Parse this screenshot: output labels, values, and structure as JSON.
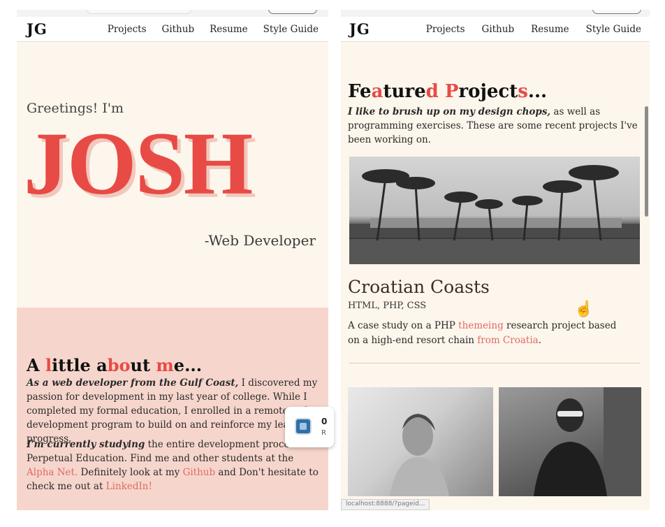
{
  "left_page": {
    "logo": "JG",
    "nav": [
      "Projects",
      "Github",
      "Resume",
      "Style Guide"
    ],
    "hero": {
      "greeting": "Greetings! I'm",
      "name": "JOSH",
      "role": "-Web Developer"
    },
    "about": {
      "title_parts": [
        "A ",
        "l",
        "ittle a",
        "bo",
        "ut ",
        "m",
        "e..."
      ],
      "p1_em": "As a web developer from the Gulf Coast,",
      "p1_text": " I discovered my passion for development in my last year of college. While I completed my formal education, I enrolled in a remote web development program to build on and reinforce my learning progress.",
      "p2_em": "I'm currently studying",
      "p2_text1": " the entire development process at Perpetual Education. Find me and other students at the ",
      "p2_link1": "Alpha Net.",
      "p2_text2": " Definitely look at my ",
      "p2_link2": "Github",
      "p2_text3": " and Don't hesitate to check me out at ",
      "p2_link3": "LinkedIn!"
    }
  },
  "right_page": {
    "logo": "JG",
    "nav": [
      "Projects",
      "Github",
      "Resume",
      "Style Guide"
    ],
    "featured": {
      "title_parts": [
        "Fe",
        "a",
        "ture",
        "d",
        " ",
        "P",
        "roject",
        "s",
        "..."
      ],
      "intro_em": "I like to brush up on my design chops,",
      "intro_text": " as well as programming exercises. These are some recent projects I've been working on."
    },
    "project": {
      "title": "Croatian Coasts",
      "tags": "HTML, PHP, CSS",
      "desc_1": "A case study on a PHP ",
      "desc_link1": "themeing",
      "desc_2": " research project based on a high-end resort chain ",
      "desc_link2": "from Croatia",
      "desc_3": "."
    },
    "status_url": "localhost:8888/?pageid..."
  },
  "notification": {
    "text": "0",
    "sub": "R"
  },
  "colors": {
    "accent": "#e84a45",
    "page_bg": "#fdf6ec",
    "about_bg": "#f6d6cc",
    "link": "#e06a65"
  },
  "icons": [
    "hand-pointer-icon",
    "app-icon"
  ]
}
